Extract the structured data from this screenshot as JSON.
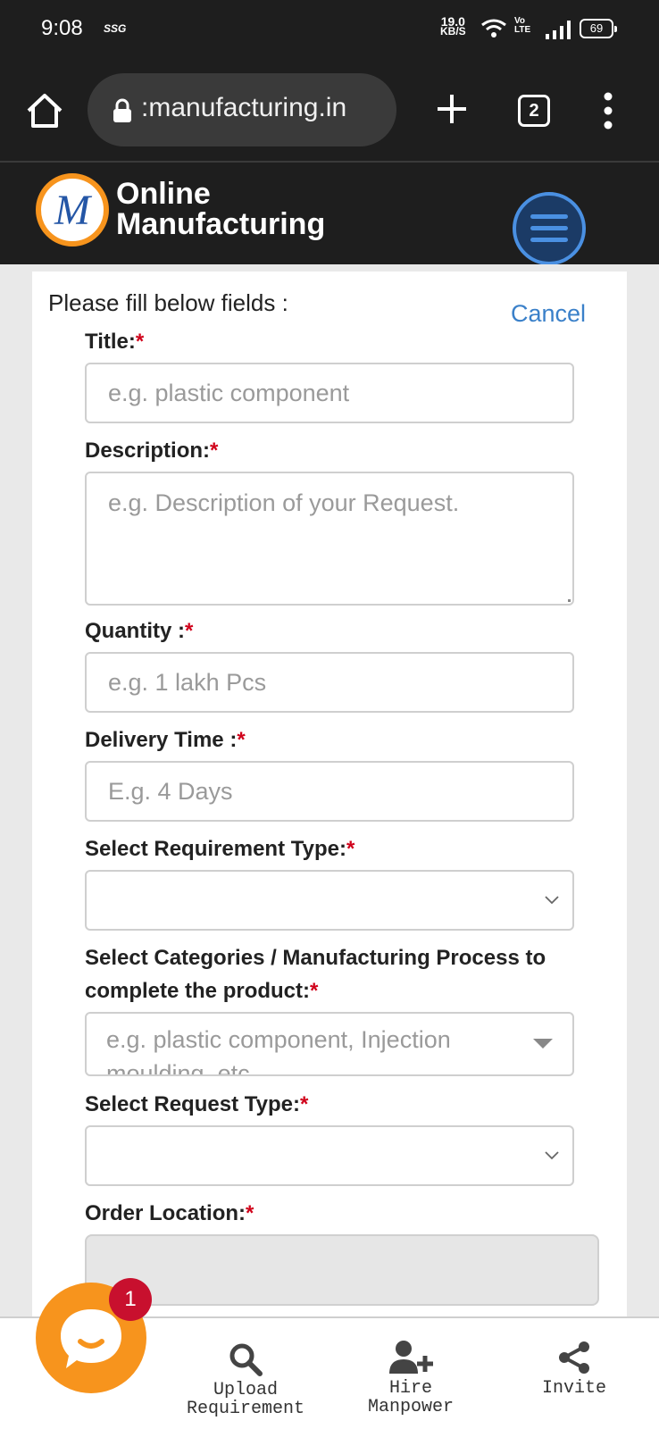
{
  "status_bar": {
    "time": "9:08",
    "carrier_tag": "SSG",
    "net_speed_value": "19.0",
    "net_speed_unit": "KB/S",
    "volte_label_top": "Vo",
    "volte_label_bottom": "LTE",
    "battery": "69"
  },
  "browser": {
    "url": ":manufacturing.in",
    "tab_count": "2"
  },
  "site": {
    "logo_letter": "M",
    "brand_line1": "Online",
    "brand_line2": "Manufacturing"
  },
  "form": {
    "intro": "Please fill below fields :",
    "cancel": "Cancel",
    "required_mark": "*",
    "title_label": "Title:",
    "title_placeholder": "e.g. plastic component",
    "description_label": "Description:",
    "description_placeholder": "e.g. Description of your Request.",
    "quantity_label": "Quantity :",
    "quantity_placeholder": "e.g. 1 lakh Pcs",
    "delivery_label": "Delivery Time :",
    "delivery_placeholder": "E.g. 4 Days",
    "requirement_type_label": "Select Requirement Type:",
    "categories_label_line1": "Select Categories / Manufacturing Process to",
    "categories_label_line2": "complete the product:",
    "categories_placeholder": "e.g. plastic component, Injection moulding, etc",
    "request_type_label": "Select Request Type:",
    "order_location_label": "Order Location:"
  },
  "bottom_nav": {
    "upload_line1": "Upload",
    "upload_line2": "Requirement",
    "hire_line1": "Hire",
    "hire_line2": "Manpower",
    "invite": "Invite"
  },
  "chat": {
    "badge_count": "1"
  },
  "colors": {
    "brand_orange": "#f7941d",
    "brand_blue": "#2456a6",
    "link_blue": "#3a80c9",
    "required_red": "#d0021b",
    "badge_red": "#c8102e"
  }
}
